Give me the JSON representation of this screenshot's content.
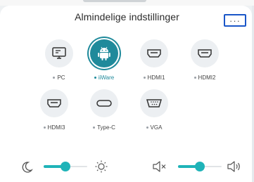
{
  "header": {
    "title": "Almindelige indstillinger",
    "more_label": "···"
  },
  "sources": [
    {
      "label": "PC",
      "icon": "monitor-icon",
      "active": false
    },
    {
      "label": "iiWare",
      "icon": "android-icon",
      "active": true
    },
    {
      "label": "HDMI1",
      "icon": "hdmi-port-icon",
      "active": false
    },
    {
      "label": "HDMI2",
      "icon": "hdmi-port-icon",
      "active": false
    },
    {
      "label": "HDMI3",
      "icon": "hdmi-port-icon",
      "active": false
    },
    {
      "label": "Type-C",
      "icon": "usb-c-port-icon",
      "active": false
    },
    {
      "label": "VGA",
      "icon": "vga-port-icon",
      "active": false
    }
  ],
  "brightness": {
    "level": 0.5,
    "low_icon": "moon-icon",
    "high_icon": "sun-icon"
  },
  "volume": {
    "level": 0.5,
    "low_icon": "volume-mute-icon",
    "high_icon": "volume-high-icon"
  },
  "colors": {
    "accent": "#1fb3b8",
    "active_source": "#1f8a9b",
    "focus_border": "#1a56c8"
  }
}
